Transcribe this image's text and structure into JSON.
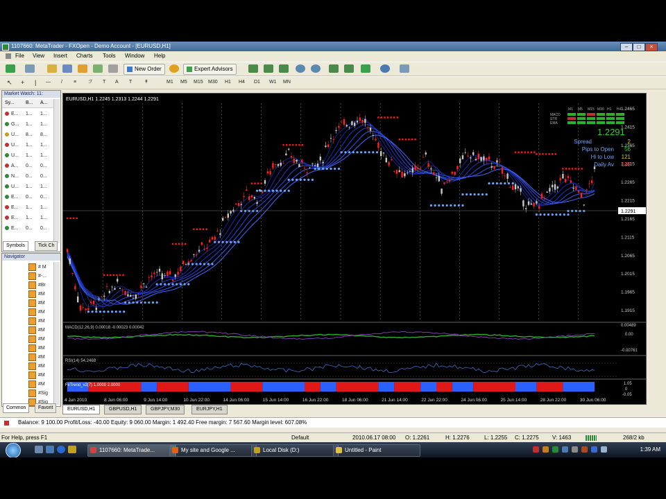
{
  "window": {
    "title": "1107660: MetaTrader - FXOpen - Demo Account - [EURUSD,H1]"
  },
  "menu": [
    "File",
    "View",
    "Insert",
    "Charts",
    "Tools",
    "Window",
    "Help"
  ],
  "toolbar": {
    "new_order": "New Order",
    "expert_advisors": "Expert Advisors"
  },
  "timeframes": [
    "M1",
    "M5",
    "M15",
    "M30",
    "H1",
    "H4",
    "D1",
    "W1",
    "MN"
  ],
  "market_watch": {
    "title": "Market Watch: 11:",
    "headers": [
      "Sy...",
      "B...",
      "A..."
    ],
    "rows": [
      {
        "sym": "E...",
        "bid": "1...",
        "ask": "1...",
        "color": "#c03030"
      },
      {
        "sym": "G...",
        "bid": "1...",
        "ask": "1...",
        "color": "#2a8a3a"
      },
      {
        "sym": "U...",
        "bid": "8...",
        "ask": "8...",
        "color": "#c0a020"
      },
      {
        "sym": "U...",
        "bid": "1...",
        "ask": "1...",
        "color": "#c03030"
      },
      {
        "sym": "U...",
        "bid": "1...",
        "ask": "1...",
        "color": "#2a8a3a"
      },
      {
        "sym": "A...",
        "bid": "0...",
        "ask": "0...",
        "color": "#c03030"
      },
      {
        "sym": "N...",
        "bid": "0...",
        "ask": "0...",
        "color": "#2a8a3a"
      },
      {
        "sym": "U...",
        "bid": "1...",
        "ask": "1...",
        "color": "#2a8a3a"
      },
      {
        "sym": "E...",
        "bid": "0...",
        "ask": "0...",
        "color": "#2a8a3a"
      },
      {
        "sym": "E...",
        "bid": "1...",
        "ask": "1...",
        "color": "#c03030"
      },
      {
        "sym": "E...",
        "bid": "1...",
        "ask": "1...",
        "color": "#c03030"
      },
      {
        "sym": "E...",
        "bid": "0...",
        "ask": "0...",
        "color": "#2a8a3a"
      }
    ],
    "tabs": [
      "Symbols",
      "Tick Ch"
    ]
  },
  "navigator": {
    "title": "Navigator",
    "items": [
      "# M",
      "#-...",
      "#Br",
      "#M",
      "#M",
      "#M",
      "#M",
      "#M",
      "#M",
      "#M",
      "#M",
      "#M",
      "#M",
      "#M",
      "#Sig",
      "#Sig"
    ],
    "tabs": [
      "Common",
      "Favorit"
    ]
  },
  "chart": {
    "symbol_header": "EURUSD,H1  1.2245 1.2313 1.2244 1.2291",
    "price_labels": [
      "1.2465",
      "1.2415",
      "1.2365",
      "1.2315",
      "1.2291",
      "1.2265",
      "1.2215",
      "1.2165",
      "1.2115",
      "1.2065",
      "1.2015",
      "1.1965",
      "1.1915"
    ],
    "time_labels": [
      "4 Jun 2010",
      "8 Jun 06:00",
      "9 Jun 14:00",
      "10 Jun 22:00",
      "14 Jun 06:00",
      "15 Jun 14:00",
      "16 Jun 22:00",
      "18 Jun 06:00",
      "21 Jun 14:00",
      "22 Jun 22:00",
      "24 Jun 06:00",
      "25 Jun 14:00",
      "28 Jun 22:00",
      "30 Jun 06:00"
    ],
    "macd_label": "MACD(12,26,9) 0.00018 -0.00023 0.00042",
    "macd_scale": [
      "0.00489",
      "0.00",
      "-0.00761"
    ],
    "rsi_label": "RSI(14) 54.2468",
    "trend_label": "FxTrend_v2(7) 1.0000 2.0000",
    "trend_scale": [
      "1.05",
      "0",
      "-0.05"
    ]
  },
  "info_panel": {
    "tf_headers": [
      "M1",
      "M5",
      "M15",
      "M30",
      "H1",
      "H4"
    ],
    "rows": [
      "MACD",
      "STR",
      "EMA"
    ],
    "price": "1.2291",
    "stats": [
      {
        "label": "Spread",
        "value": "2"
      },
      {
        "label": "Pips to Open",
        "value": "56"
      },
      {
        "label": "Hi to Low",
        "value": "121"
      },
      {
        "label": "Daily Av",
        "value": "135"
      }
    ]
  },
  "chart_tabs": [
    "EURUSD,H1",
    "GBPUSD,H1",
    "GBPJPY,M30",
    "EURJPY,H1"
  ],
  "account_line": "Balance: 9 100.00  Profit/Loss: -40.00  Equity: 9 060.00  Margin: 1 492.40  Free margin: 7 567.60  Margin level: 607.08%",
  "status": {
    "help": "For Help, press F1",
    "profile": "Default",
    "datetime": "2010.06.17 08:00",
    "open": "O: 1.2261",
    "high": "H: 1.2276",
    "low": "L: 1.2255",
    "close": "C: 1.2275",
    "volume": "V: 1463",
    "traffic": "268/2 kb"
  },
  "taskbar": {
    "items": [
      "1107660: MetaTrade...",
      "My site and Google ...",
      "Local Disk (D:)",
      "Untitled - Paint"
    ],
    "clock": "1:39 AM"
  },
  "colors": {
    "bull": "#c8c8c8",
    "bear": "#ff2020",
    "ribbon": "#2030c0",
    "stop_blue": "#6aa6ff",
    "stop_red": "#ff1a1a",
    "trend_red": "#e01818",
    "trend_blue": "#2a60ff"
  }
}
